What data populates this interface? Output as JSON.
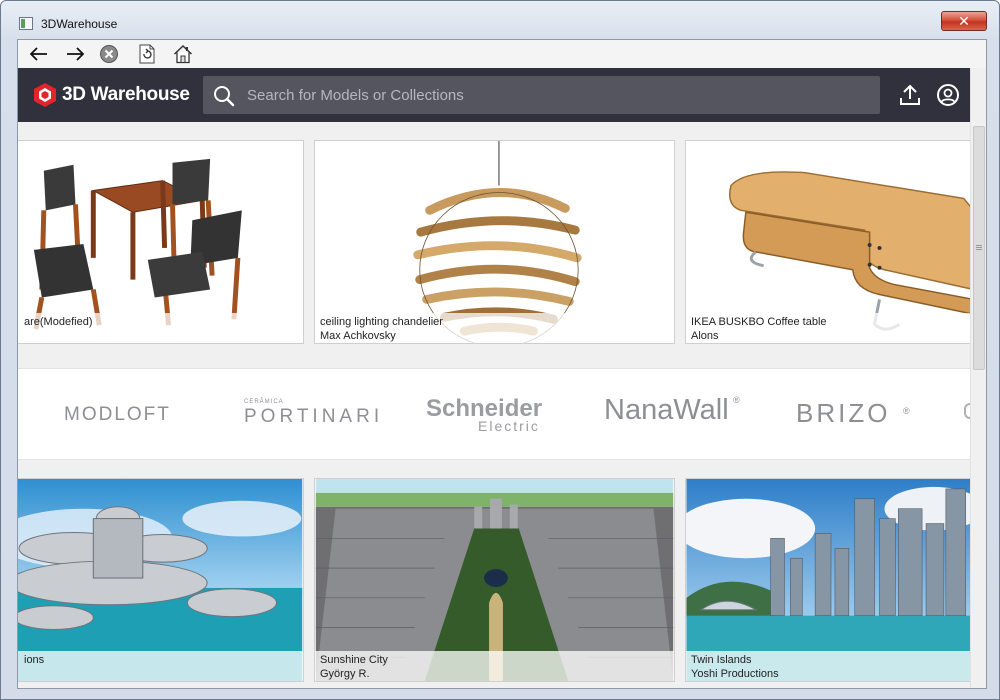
{
  "window": {
    "title": "3DWarehouse",
    "close_label": "✕"
  },
  "toolbar": {
    "icons": [
      "back-arrow-icon",
      "forward-arrow-icon",
      "stop-icon",
      "refresh-icon",
      "home-icon"
    ]
  },
  "header": {
    "logo_text": "3D Warehouse",
    "search": {
      "placeholder": "Search for Models or Collections",
      "value": ""
    },
    "icons": [
      "upload-icon",
      "account-icon"
    ]
  },
  "models_top": [
    {
      "title": "are(Modefied)",
      "author": ""
    },
    {
      "title": "ceiling lighting chandelier",
      "author": "Max Achkovsky"
    },
    {
      "title": "IKEA BUSKBO Coffee table",
      "author": "Alons"
    }
  ],
  "brands": {
    "modloft": "MODLOFT",
    "portinari_small": "CERÂMICA",
    "portinari": "PORTINARI",
    "schneider": "Schneider",
    "schneider_sub": "Electric",
    "nanawall": "NanaWall",
    "nanawall_mark": "®",
    "brizo": "BRIZO",
    "brizo_mark": "®"
  },
  "models_bottom": [
    {
      "title": "ions",
      "author": ""
    },
    {
      "title": "Sunshine City",
      "author": "György R."
    },
    {
      "title": "Twin Islands",
      "author": "Yoshi Productions"
    }
  ],
  "colors": {
    "header_bg": "#30313c",
    "search_bg": "#54555f",
    "logo_red": "#e0262b",
    "close_red": "#c4321d"
  }
}
